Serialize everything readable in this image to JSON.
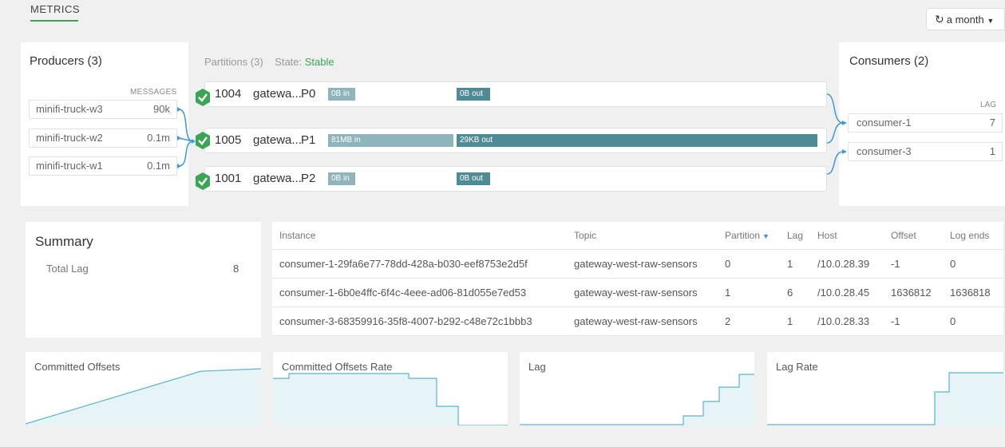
{
  "header": {
    "tab_label": "METRICS",
    "range_label": "a month",
    "range_icon": "refresh-icon"
  },
  "producers": {
    "title": "Producers (3)",
    "column_header": "MESSAGES",
    "items": [
      {
        "name": "minifi-truck-w3",
        "messages": "90k"
      },
      {
        "name": "minifi-truck-w2",
        "messages": "0.1m"
      },
      {
        "name": "minifi-truck-w1",
        "messages": "0.1m"
      }
    ]
  },
  "partitions": {
    "title": "Partitions (3)",
    "state_label": "State:",
    "state_value": "Stable",
    "items": [
      {
        "id": "1004",
        "topic": "gatewa...",
        "partition": "P0",
        "in": "0B in",
        "out": "0B out",
        "in_fraction": 0.0,
        "out_fraction": 0.0
      },
      {
        "id": "1005",
        "topic": "gatewa...",
        "partition": "P1",
        "in": "81MB in",
        "out": "29KB out",
        "in_fraction": 1.0,
        "out_fraction": 1.0
      },
      {
        "id": "1001",
        "topic": "gatewa...",
        "partition": "P2",
        "in": "0B in",
        "out": "0B out",
        "in_fraction": 0.0,
        "out_fraction": 0.0
      }
    ]
  },
  "consumers": {
    "title": "Consumers (2)",
    "column_header": "LAG",
    "items": [
      {
        "name": "consumer-1",
        "lag": "7"
      },
      {
        "name": "consumer-3",
        "lag": "1"
      }
    ]
  },
  "summary": {
    "title": "Summary",
    "total_lag_label": "Total Lag",
    "total_lag_value": "8"
  },
  "instances_table": {
    "columns": [
      "Instance",
      "Topic",
      "Partition",
      "Lag",
      "Host",
      "Offset",
      "Log ends"
    ],
    "sorted_column": "Partition",
    "rows": [
      [
        "consumer-1-29fa6e77-78dd-428a-b030-eef8753e2d5f",
        "gateway-west-raw-sensors",
        "0",
        "1",
        "/10.0.28.39",
        "-1",
        "0"
      ],
      [
        "consumer-1-6b0e4ffc-6f4c-4eee-ad06-81d055e7ed53",
        "gateway-west-raw-sensors",
        "1",
        "6",
        "/10.0.28.45",
        "1636812",
        "1636818"
      ],
      [
        "consumer-3-68359916-35f8-4007-b292-c48e72c1bbb3",
        "gateway-west-raw-sensors",
        "2",
        "1",
        "/10.0.28.33",
        "-1",
        "0"
      ]
    ]
  },
  "mini_charts": [
    {
      "title": "Committed Offsets"
    },
    {
      "title": "Committed Offsets Rate"
    },
    {
      "title": "Lag"
    },
    {
      "title": "Lag Rate"
    }
  ],
  "colors": {
    "accent_green": "#3aa655",
    "bar_in": "#8fb4bc",
    "bar_out": "#4f8b95",
    "chart_line": "#5ab4cf",
    "chart_fill": "#e6f3f7",
    "link_blue": "#3a9ad9"
  }
}
